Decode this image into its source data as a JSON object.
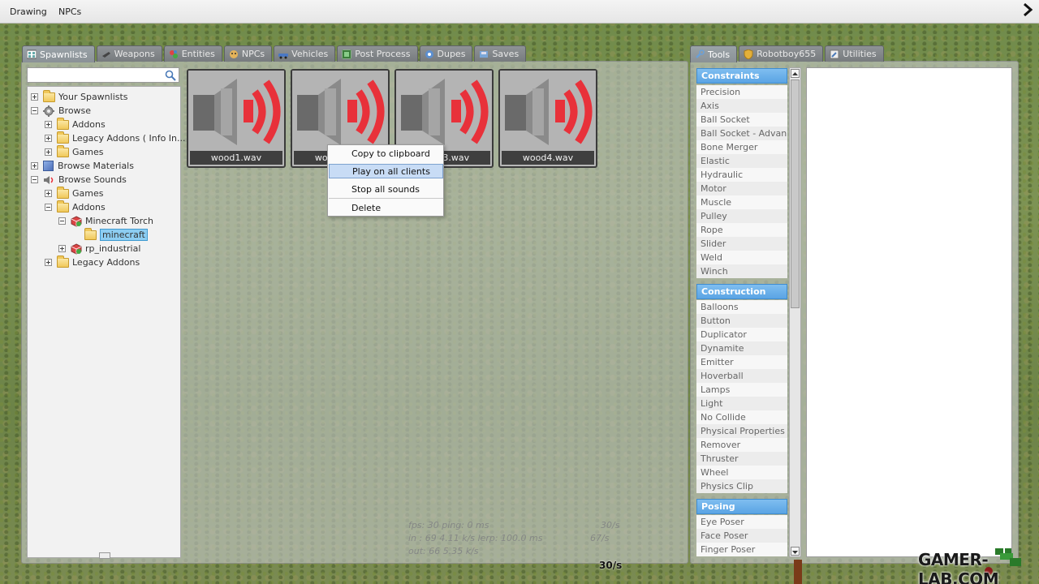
{
  "menubar": {
    "items": [
      "Drawing",
      "NPCs"
    ]
  },
  "spawn_tabs": [
    {
      "label": "Spawnlists",
      "icon": "spawnlist-icon",
      "active": true
    },
    {
      "label": "Weapons",
      "icon": "weapon-icon"
    },
    {
      "label": "Entities",
      "icon": "entity-icon"
    },
    {
      "label": "NPCs",
      "icon": "npc-icon"
    },
    {
      "label": "Vehicles",
      "icon": "vehicle-icon"
    },
    {
      "label": "Post Process",
      "icon": "postprocess-icon"
    },
    {
      "label": "Dupes",
      "icon": "dupe-icon"
    },
    {
      "label": "Saves",
      "icon": "save-icon"
    }
  ],
  "tool_tabs": [
    {
      "label": "Tools",
      "icon": "wrench-icon",
      "active": true
    },
    {
      "label": "Robotboy655",
      "icon": "shield-icon"
    },
    {
      "label": "Utilities",
      "icon": "utility-icon"
    }
  ],
  "search": {
    "value": "",
    "placeholder": ""
  },
  "tree": {
    "your_spawnlists": "Your Spawnlists",
    "browse": "Browse",
    "addons": "Addons",
    "legacy_addons_info": "Legacy Addons ( Info In...",
    "games": "Games",
    "browse_materials": "Browse Materials",
    "browse_sounds": "Browse Sounds",
    "sounds_games": "Games",
    "sounds_addons": "Addons",
    "minecraft_torch": "Minecraft Torch",
    "minecraft": "minecraft",
    "rp_industrial": "rp_industrial",
    "legacy_addons": "Legacy Addons"
  },
  "tiles": [
    "wood1.wav",
    "wood2.wav",
    "wood3.wav",
    "wood4.wav"
  ],
  "context_menu": {
    "items": [
      "Copy to clipboard",
      "Play on all clients",
      "Stop all sounds",
      "Delete"
    ],
    "hovered": "Play on all clients"
  },
  "net_stats": {
    "fps": "fps:  30   ping: 0 ms",
    "in": "in :  69   4.11 k/s   lerp: 100.0 ms",
    "out": "out: 66   5.35 k/s",
    "rate1": "30/s",
    "rate2": "67/s",
    "fps_bottom": "30/s"
  },
  "tools": {
    "constraints_header": "Constraints",
    "constraints": [
      "Precision",
      "Axis",
      "Ball Socket",
      "Ball Socket - Advan...",
      "Bone Merger",
      "Elastic",
      "Hydraulic",
      "Motor",
      "Muscle",
      "Pulley",
      "Rope",
      "Slider",
      "Weld",
      "Winch"
    ],
    "construction_header": "Construction",
    "construction": [
      "Balloons",
      "Button",
      "Duplicator",
      "Dynamite",
      "Emitter",
      "Hoverball",
      "Lamps",
      "Light",
      "No Collide",
      "Physical Properties",
      "Remover",
      "Thruster",
      "Wheel",
      "Physics Clip"
    ],
    "posing_header": "Posing",
    "posing": [
      "Eye Poser",
      "Face Poser",
      "Finger Poser"
    ]
  },
  "watermark": "GAMER-LAB.COM",
  "colors": {
    "header_blue": "#5aa4e4",
    "selected_blue": "#8ccdf2",
    "tab_gray": "#7f8386",
    "speaker_red": "#e8313a"
  }
}
